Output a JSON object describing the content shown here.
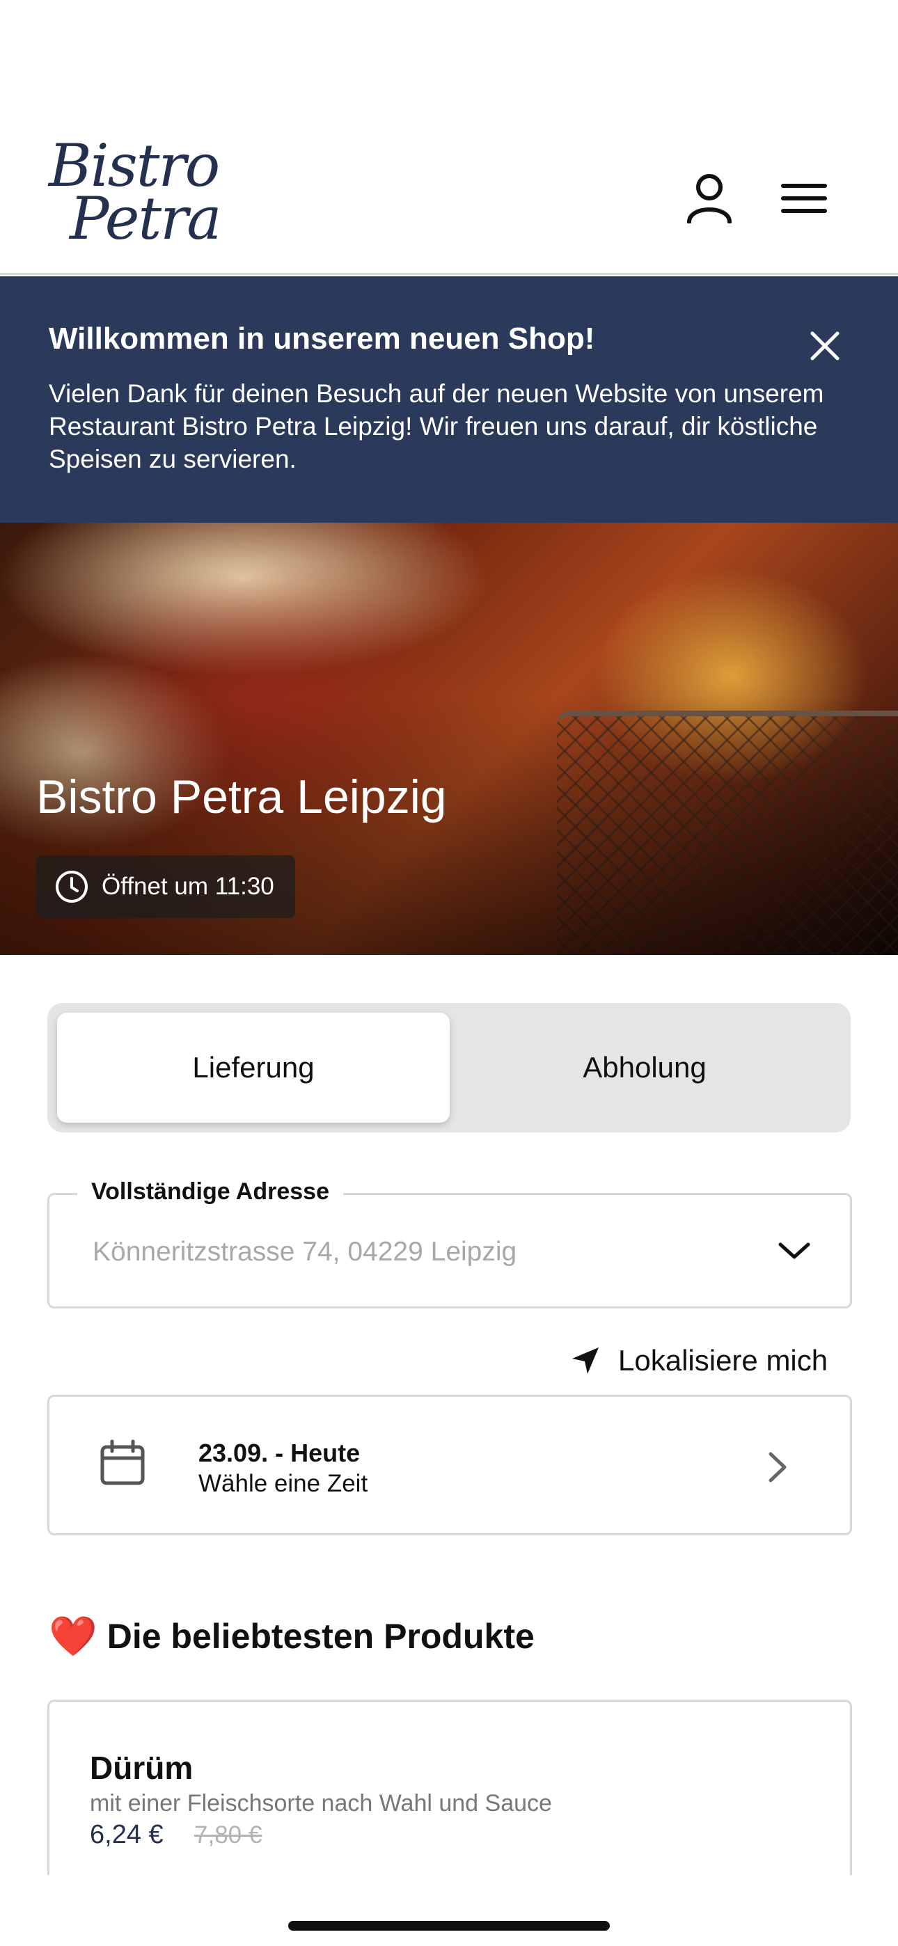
{
  "header": {
    "logo_line1": "Bistro",
    "logo_line2": "Petra",
    "user_icon": "user-icon",
    "menu_icon": "hamburger-menu-icon"
  },
  "banner": {
    "title": "Willkommen in unserem neuen Shop!",
    "text": "Vielen Dank für deinen Besuch auf der neuen Website von unserem Restaurant Bistro Petra Leipzig! Wir freuen uns darauf, dir köstliche Speisen zu servieren.",
    "close_icon": "close-icon",
    "background": "#2b3a5b"
  },
  "hero": {
    "title": "Bistro Petra Leipzig",
    "opening": "Öffnet um 11:30",
    "clock_icon": "clock-icon"
  },
  "order_mode": {
    "options": [
      "Lieferung",
      "Abholung"
    ],
    "selected": "Lieferung"
  },
  "address": {
    "label": "Vollständige Adresse",
    "placeholder": "Könneritzstrasse 74, 04229 Leipzig",
    "dropdown_icon": "chevron-down-icon"
  },
  "locate": {
    "label": "Lokalisiere mich",
    "icon": "location-arrow-icon"
  },
  "date": {
    "date_label": "23.09. - Heute",
    "sub_label": "Wähle eine Zeit",
    "icon": "calendar-icon"
  },
  "popular": {
    "heart": "❤️",
    "title": "Die beliebtesten Produkte",
    "products": [
      {
        "name": "Dürüm",
        "description": "mit einer Fleischsorte nach Wahl und Sauce",
        "price": "6,24 €",
        "old_price": "7,80 €"
      }
    ]
  },
  "colors": {
    "brand_navy": "#23304f",
    "banner_bg": "#2b3a5b",
    "heart_red": "#e0282e"
  }
}
